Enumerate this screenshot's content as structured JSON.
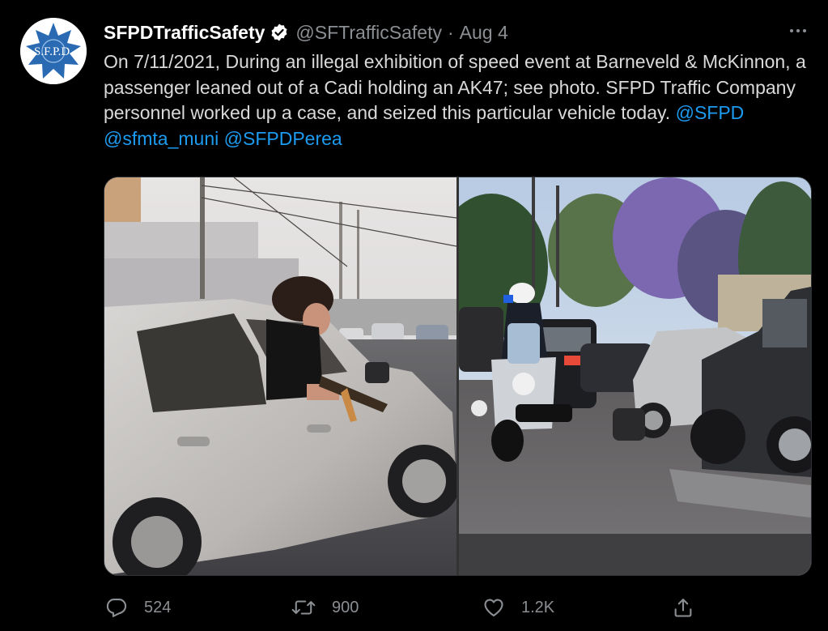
{
  "account": {
    "name": "SFPDTrafficSafety",
    "handle": "@SFTrafficSafety",
    "separator": "·",
    "date": "Aug 4",
    "avatar_text": "S.F.P.D."
  },
  "tweet": {
    "text": "On 7/11/2021, During an illegal exhibition of speed event at Barneveld & McKinnon, a passenger leaned out of a Cadi holding an AK47; see photo. SFPD Traffic Company personnel worked up a case, and seized this particular vehicle today. ",
    "mentions": [
      "@SFPD",
      "@sfmta_muni",
      "@SFPDPerea"
    ]
  },
  "actions": {
    "reply_count": "524",
    "retweet_count": "900",
    "like_count": "1.2K"
  },
  "icons": {
    "verified": "verified-badge-icon",
    "more": "more-options-icon",
    "reply": "reply-icon",
    "retweet": "retweet-icon",
    "like": "heart-icon",
    "share": "share-icon"
  },
  "colors": {
    "background": "#000000",
    "text": "#d9d9d9",
    "muted": "#8b8f93",
    "link": "#1d9bf0",
    "badge_blue": "#2a6ab3"
  }
}
